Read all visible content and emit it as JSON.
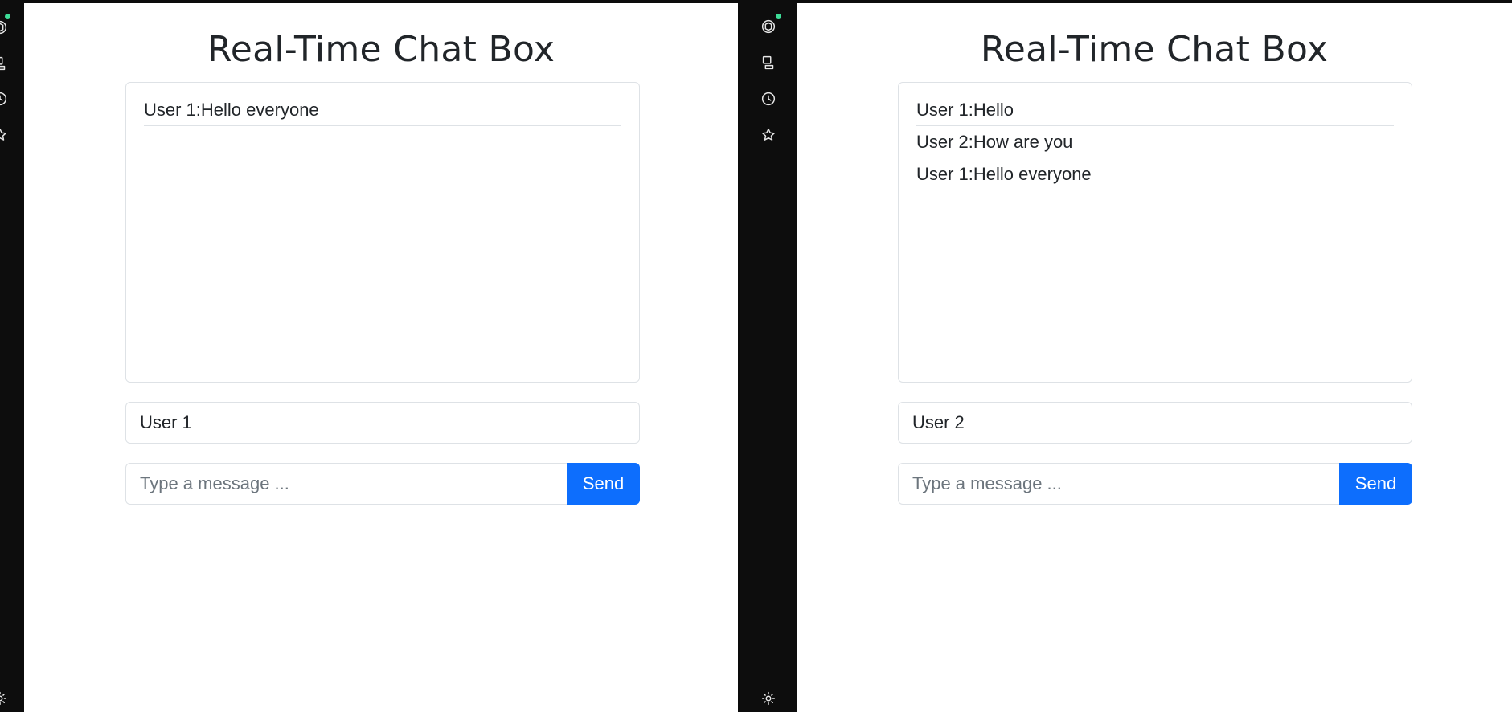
{
  "left_window": {
    "title": "Real-Time Chat Box",
    "messages": [
      "User 1:Hello everyone"
    ],
    "username_value": "User 1",
    "message_placeholder": "Type a message ...",
    "send_label": "Send"
  },
  "right_window": {
    "title": "Real-Time Chat Box",
    "messages": [
      "User 1:Hello",
      "User 2:How are you",
      "User 1:Hello everyone"
    ],
    "username_value": "User 2",
    "message_placeholder": "Type a message ...",
    "send_label": "Send"
  },
  "sidebar": {
    "icons": [
      "chatgpt-icon",
      "robot-icon",
      "history-icon",
      "star-icon",
      "settings-icon"
    ]
  },
  "colors": {
    "accent": "#0d6efd",
    "rail": "#0d0d0d",
    "status_dot": "#3ddc97"
  }
}
